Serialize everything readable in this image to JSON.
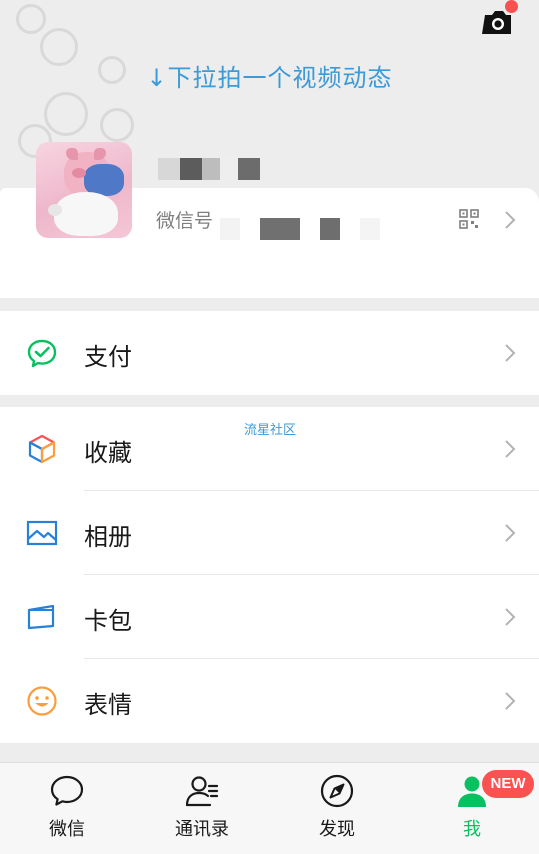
{
  "header": {
    "pull_hint": "↓下拉拍一个视频动态",
    "camera_icon": "camera-icon"
  },
  "profile": {
    "wechat_id_label": "微信号",
    "qr_icon": "qr-code-icon"
  },
  "watermark": "流星社区",
  "menu_groups": [
    {
      "items": [
        {
          "label": "支付",
          "icon": "wallet-icon",
          "color": "#07c160"
        }
      ]
    },
    {
      "items": [
        {
          "label": "收藏",
          "icon": "cube-icon",
          "color": "#fa9d3b"
        },
        {
          "label": "相册",
          "icon": "photo-icon",
          "color": "#2782d7"
        },
        {
          "label": "卡包",
          "icon": "card-icon",
          "color": "#2782d7"
        },
        {
          "label": "表情",
          "icon": "smiley-icon",
          "color": "#fa9d3b"
        }
      ]
    }
  ],
  "tabbar": {
    "tabs": [
      {
        "label": "微信",
        "icon": "chat-bubble-icon",
        "active": false
      },
      {
        "label": "通讯录",
        "icon": "contacts-icon",
        "active": false
      },
      {
        "label": "发现",
        "icon": "compass-icon",
        "active": false
      },
      {
        "label": "我",
        "icon": "person-icon",
        "active": true
      }
    ],
    "badge": "NEW"
  },
  "colors": {
    "accent_green": "#07c160",
    "hint_blue": "#3a9bd8",
    "badge_red": "#fa5151",
    "background": "#ededed"
  }
}
